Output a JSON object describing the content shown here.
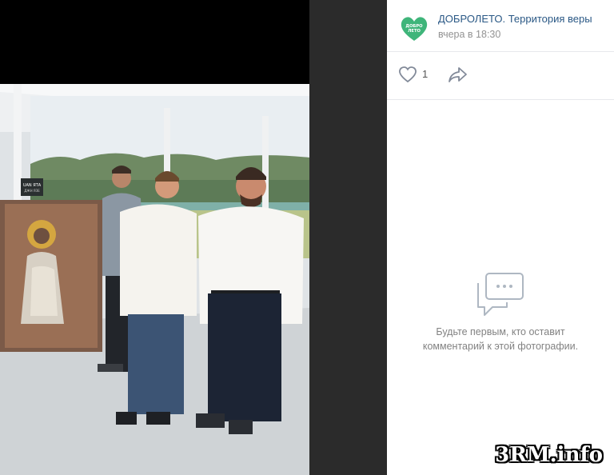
{
  "post": {
    "author": "ДОБРОЛЕТО. Территория веры",
    "date": "вчера в 18:30",
    "avatar_text_top": "ДОБРО",
    "avatar_text_bottom": "ЛЕТО",
    "avatar_color": "#3fb57a"
  },
  "actions": {
    "like_count": "1",
    "like_icon": "heart-icon",
    "share_icon": "share-arrow-icon"
  },
  "comments": {
    "empty_line1": "Будьте первым, кто оставит",
    "empty_line2": "комментарий к этой фотографии.",
    "empty_icon": "comments-bubble-icon"
  },
  "photo": {
    "sign_text_line1": "UAN ЯТА",
    "sign_text_line2": "ДЖН ЯЗЕ"
  },
  "watermark": "3RM.info"
}
